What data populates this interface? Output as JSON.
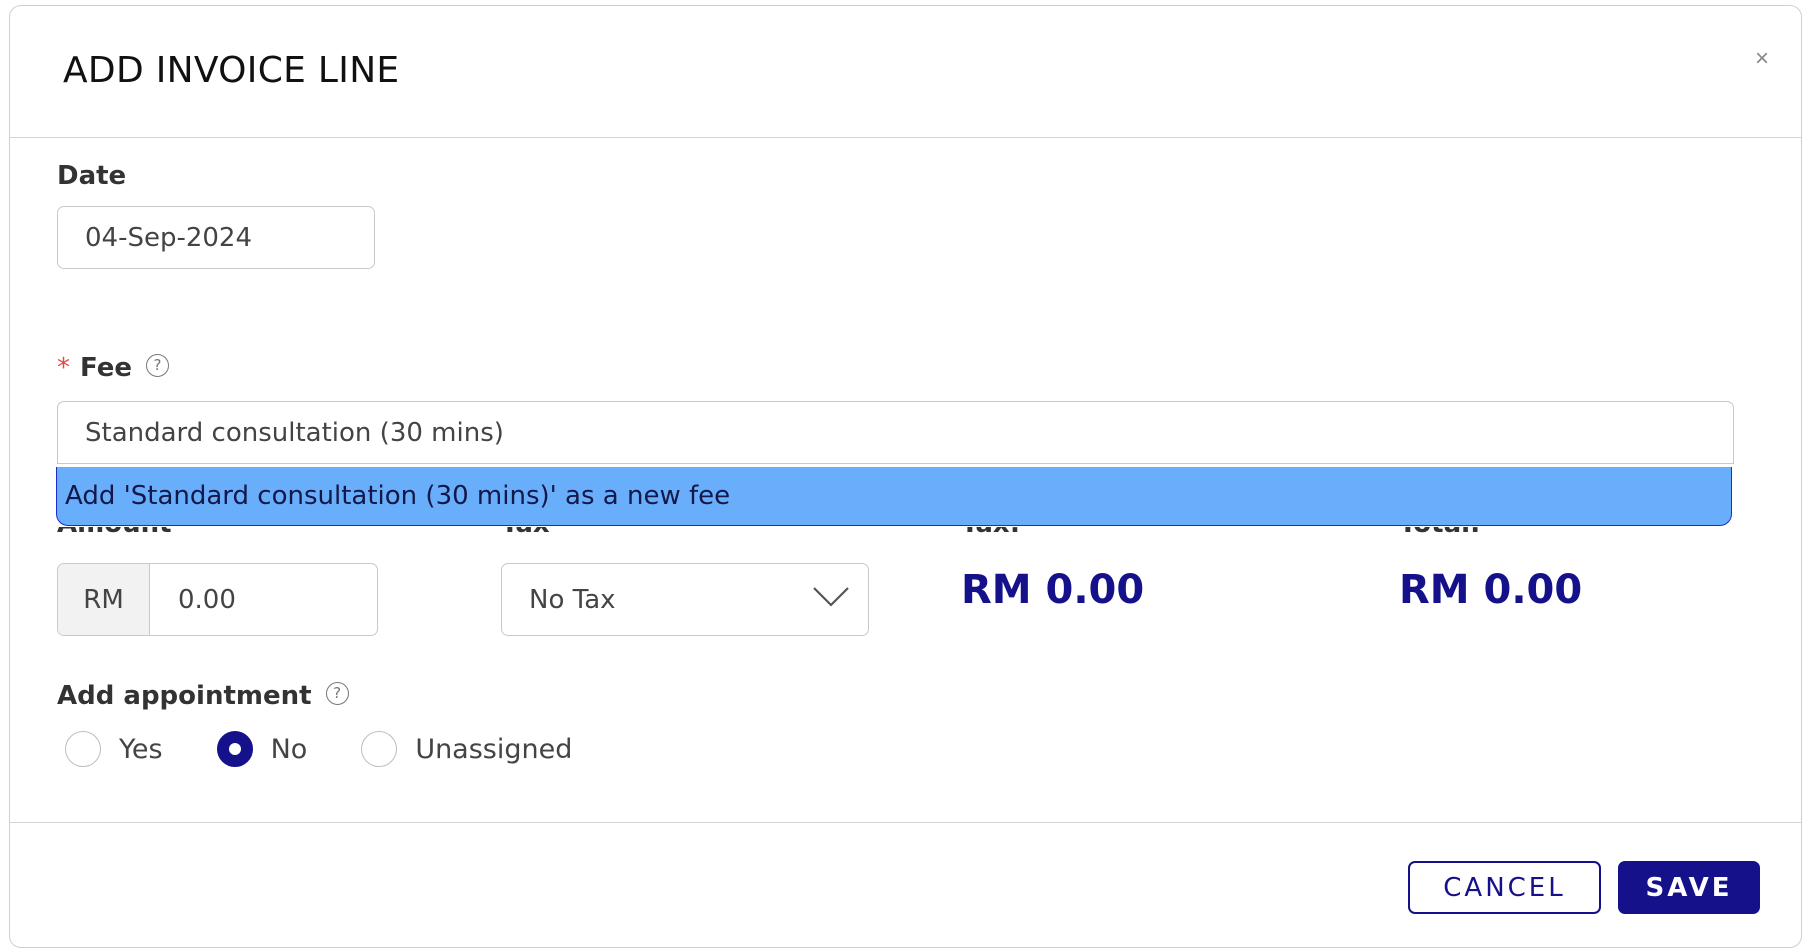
{
  "modal": {
    "title": "ADD INVOICE LINE",
    "close_symbol": "×"
  },
  "date": {
    "label": "Date",
    "value": "04-Sep-2024"
  },
  "fee": {
    "required_marker": "*",
    "label": "Fee",
    "help_symbol": "?",
    "value": "Standard consultation (30 mins)",
    "dropdown_option": "Add 'Standard consultation (30 mins)' as a new fee"
  },
  "amount": {
    "label": "Amount",
    "prefix": "RM",
    "value": "0.00"
  },
  "tax_select": {
    "label": "Tax",
    "value": "No Tax"
  },
  "tax_total": {
    "label": "Tax:",
    "value": "RM 0.00"
  },
  "total": {
    "label": "Total:",
    "value": "RM 0.00"
  },
  "appointment": {
    "label": "Add appointment",
    "help_symbol": "?",
    "options": [
      {
        "label": "Yes",
        "checked": false
      },
      {
        "label": "No",
        "checked": true
      },
      {
        "label": "Unassigned",
        "checked": false
      }
    ]
  },
  "footer": {
    "cancel_label": "CANCEL",
    "save_label": "SAVE"
  },
  "colors": {
    "accent": "#14118a",
    "highlight": "#69aefb",
    "required": "#e34b4b"
  }
}
